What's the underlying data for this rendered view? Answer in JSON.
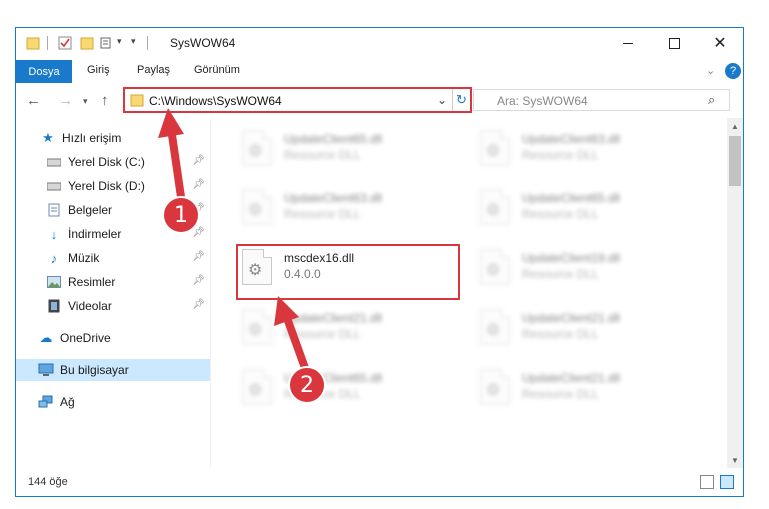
{
  "window": {
    "title": "SysWOW64"
  },
  "ribbon": {
    "tabs": [
      "Dosya",
      "Giriş",
      "Paylaş",
      "Görünüm"
    ]
  },
  "address": {
    "path": "C:\\Windows\\SysWOW64"
  },
  "search": {
    "placeholder": "Ara: SysWOW64"
  },
  "sidebar": {
    "items": [
      {
        "label": "Hızlı erişim",
        "icon": "star-icon",
        "pinned": false
      },
      {
        "label": "Yerel Disk (C:)",
        "icon": "drive-icon",
        "pinned": true
      },
      {
        "label": "Yerel Disk (D:)",
        "icon": "drive-icon",
        "pinned": true
      },
      {
        "label": "Belgeler",
        "icon": "documents-icon",
        "pinned": true
      },
      {
        "label": "İndirmeler",
        "icon": "download-icon",
        "pinned": true
      },
      {
        "label": "Müzik",
        "icon": "music-icon",
        "pinned": true
      },
      {
        "label": "Resimler",
        "icon": "pictures-icon",
        "pinned": true
      },
      {
        "label": "Videolar",
        "icon": "videos-icon",
        "pinned": true
      },
      {
        "label": "OneDrive",
        "icon": "cloud-icon",
        "pinned": false
      },
      {
        "label": "Bu bilgisayar",
        "icon": "computer-icon",
        "pinned": false
      },
      {
        "label": "Ağ",
        "icon": "network-icon",
        "pinned": false
      }
    ]
  },
  "files": {
    "left": [
      {
        "name": "UpdateClient65.dll",
        "sub": "Resource DLL"
      },
      {
        "name": "UpdateClient63.dll",
        "sub": "Resource DLL"
      },
      {
        "name": "mscdex16.dll",
        "sub": "0.4.0.0"
      },
      {
        "name": "UpdateClient21.dll",
        "sub": "Resource DLL"
      },
      {
        "name": "UpdateClient65.dll",
        "sub": "Resource DLL"
      }
    ],
    "right": [
      {
        "name": "UpdateClient63.dll",
        "sub": "Resource DLL"
      },
      {
        "name": "UpdateClient65.dll",
        "sub": "Resource DLL"
      },
      {
        "name": "UpdateClient19.dll",
        "sub": "Resource DLL"
      },
      {
        "name": "UpdateClient21.dll",
        "sub": "Resource DLL"
      },
      {
        "name": "UpdateClient21.dll",
        "sub": "Resource DLL"
      }
    ]
  },
  "status": {
    "count": "144 öğe"
  },
  "annotations": {
    "step1": "1",
    "step2": "2"
  },
  "colors": {
    "accent": "#1979ca",
    "highlight": "#d9363e",
    "selected": "#cce8ff"
  }
}
